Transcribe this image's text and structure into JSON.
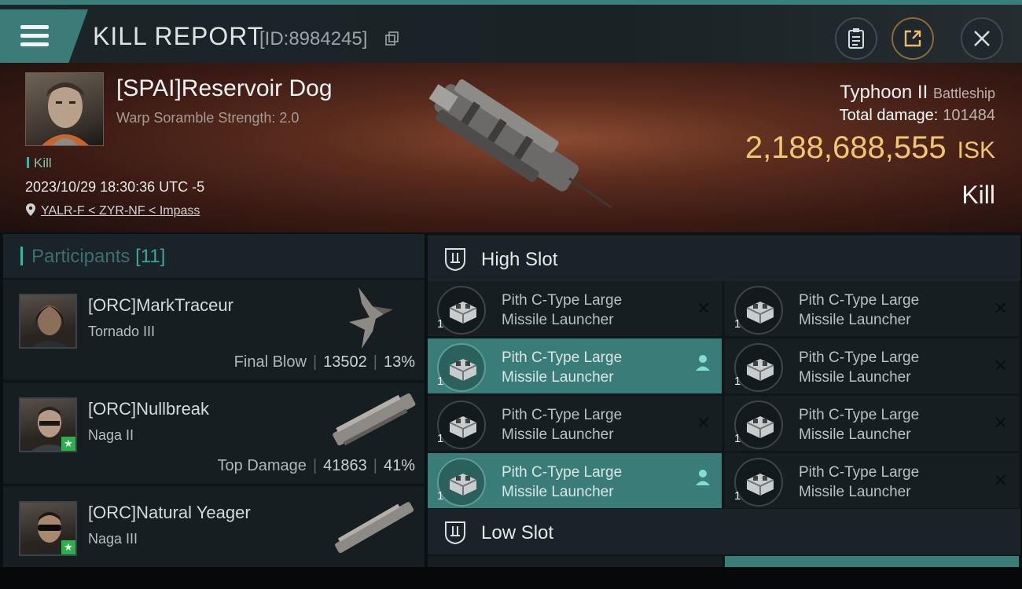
{
  "header": {
    "title": "KILL REPORT",
    "report_id": "[ID:8984245]",
    "buttons": [
      "clipboard-icon",
      "share-icon",
      "close-icon"
    ]
  },
  "victim": {
    "pilot": "[SPAI]Reservoir Dog",
    "warp_scramble": "Warp Soramble Strength: 2.0",
    "tag": "Kill",
    "datetime": "2023/10/29 18:30:36 UTC -5",
    "location": "YALR-F < ZYR-NF < Impass",
    "ship": "Typhoon II",
    "ship_class": "Battleship",
    "total_damage_label": "Total damage:",
    "total_damage": "101484",
    "isk_value": "2,188,688,555",
    "isk_unit": "ISK",
    "result": "Kill"
  },
  "participants": {
    "title": "Participants",
    "count": "[11]",
    "list": [
      {
        "name": "[ORC]MarkTraceur",
        "ship": "Tornado III",
        "role": "Final Blow",
        "damage": "13502",
        "percent": "13%",
        "starred": false
      },
      {
        "name": "[ORC]Nullbreak",
        "ship": "Naga II",
        "role": "Top Damage",
        "damage": "41863",
        "percent": "41%",
        "starred": true
      },
      {
        "name": "[ORC]Natural Yeager",
        "ship": "Naga III",
        "role": "",
        "damage": "",
        "percent": "",
        "starred": true
      }
    ]
  },
  "slots": {
    "high": {
      "title": "High Slot",
      "modules": [
        {
          "line1": "Pith C-Type Large",
          "line2": "Missile Launcher",
          "qty": "1",
          "highlight": false,
          "status": "destroyed"
        },
        {
          "line1": "Pith C-Type Large",
          "line2": "Missile Launcher",
          "qty": "1",
          "highlight": false,
          "status": "destroyed"
        },
        {
          "line1": "Pith C-Type Large",
          "line2": "Missile Launcher",
          "qty": "1",
          "highlight": true,
          "status": "dropped"
        },
        {
          "line1": "Pith C-Type Large",
          "line2": "Missile Launcher",
          "qty": "1",
          "highlight": false,
          "status": "destroyed"
        },
        {
          "line1": "Pith C-Type Large",
          "line2": "Missile Launcher",
          "qty": "1",
          "highlight": false,
          "status": "destroyed"
        },
        {
          "line1": "Pith C-Type Large",
          "line2": "Missile Launcher",
          "qty": "1",
          "highlight": false,
          "status": "destroyed"
        },
        {
          "line1": "Pith C-Type Large",
          "line2": "Missile Launcher",
          "qty": "1",
          "highlight": true,
          "status": "dropped"
        },
        {
          "line1": "Pith C-Type Large",
          "line2": "Missile Launcher",
          "qty": "1",
          "highlight": false,
          "status": "destroyed"
        }
      ]
    },
    "low": {
      "title": "Low Slot"
    }
  }
}
